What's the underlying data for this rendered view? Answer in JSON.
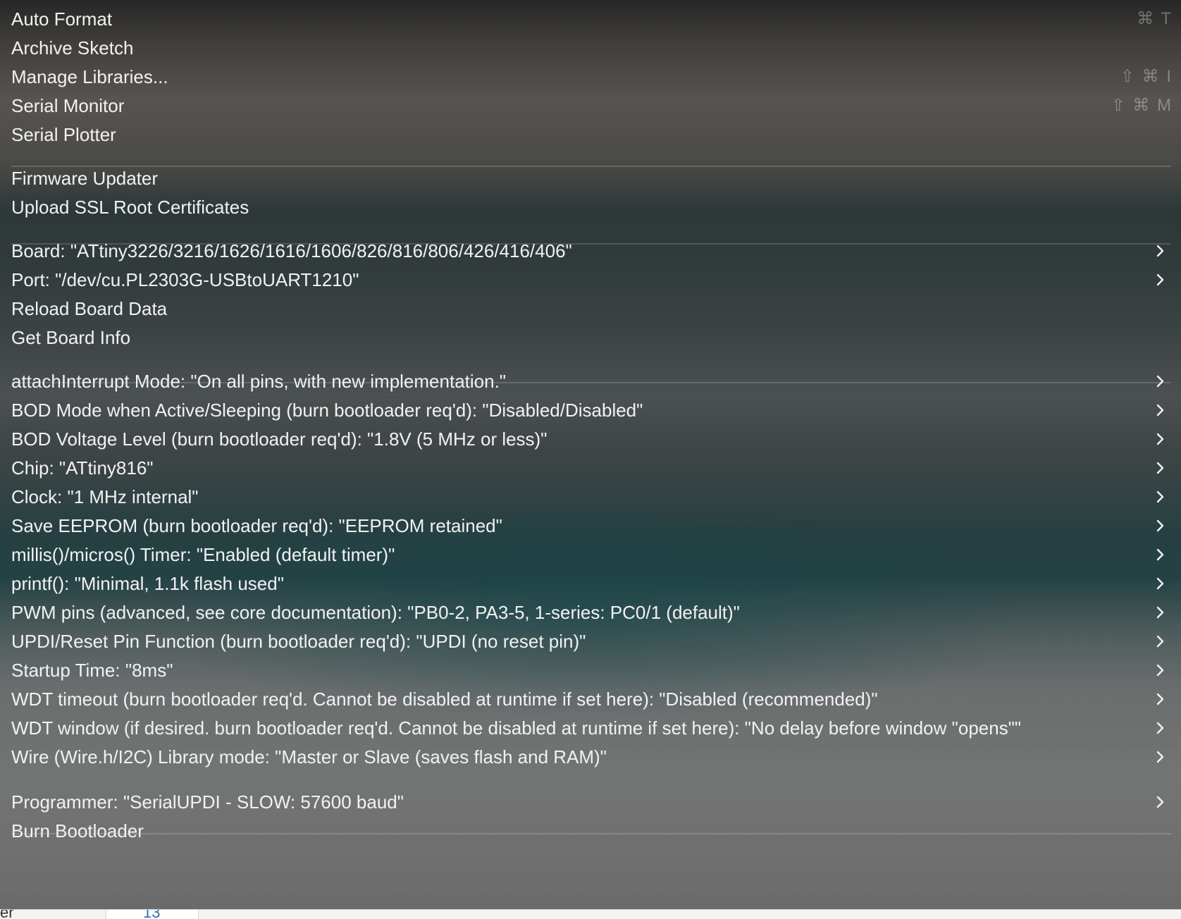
{
  "menu": {
    "group_edit": [
      {
        "label": "Auto Format",
        "shortcut": "⌘ T",
        "submenu": false
      },
      {
        "label": "Archive Sketch",
        "shortcut": "",
        "submenu": false
      },
      {
        "label": "Manage Libraries...",
        "shortcut": "⇧ ⌘ I",
        "submenu": false
      },
      {
        "label": "Serial Monitor",
        "shortcut": "⇧ ⌘ M",
        "submenu": false
      },
      {
        "label": "Serial Plotter",
        "shortcut": "",
        "submenu": false
      }
    ],
    "group_firmware": [
      {
        "label": "Firmware Updater",
        "submenu": false
      },
      {
        "label": "Upload SSL Root Certificates",
        "submenu": false
      }
    ],
    "group_board": [
      {
        "label": "Board: \"ATtiny3226/3216/1626/1616/1606/826/816/806/426/416/406\"",
        "submenu": true
      },
      {
        "label": "Port: \"/dev/cu.PL2303G-USBtoUART1210\"",
        "submenu": true
      },
      {
        "label": "Reload Board Data",
        "submenu": false
      },
      {
        "label": "Get Board Info",
        "submenu": false
      }
    ],
    "group_options": [
      {
        "label": "attachInterrupt Mode: \"On all pins, with new implementation.\"",
        "submenu": true
      },
      {
        "label": "BOD Mode when Active/Sleeping (burn bootloader req'd): \"Disabled/Disabled\"",
        "submenu": true
      },
      {
        "label": "BOD Voltage Level (burn bootloader req'd): \"1.8V (5 MHz or less)\"",
        "submenu": true
      },
      {
        "label": "Chip: \"ATtiny816\"",
        "submenu": true
      },
      {
        "label": "Clock: \"1 MHz internal\"",
        "submenu": true
      },
      {
        "label": "Save EEPROM (burn bootloader req'd): \"EEPROM retained\"",
        "submenu": true
      },
      {
        "label": "millis()/micros() Timer: \"Enabled (default timer)\"",
        "submenu": true
      },
      {
        "label": "printf(): \"Minimal, 1.1k flash used\"",
        "submenu": true
      },
      {
        "label": "PWM pins (advanced, see core documentation): \"PB0-2, PA3-5, 1-series: PC0/1 (default)\"",
        "submenu": true
      },
      {
        "label": "UPDI/Reset Pin Function (burn bootloader req'd): \"UPDI (no reset pin)\"",
        "submenu": true
      },
      {
        "label": "Startup Time: \"8ms\"",
        "submenu": true
      },
      {
        "label": "WDT timeout (burn bootloader req'd. Cannot be disabled at runtime if set here): \"Disabled (recommended)\"",
        "submenu": true
      },
      {
        "label": "WDT window (if desired. burn bootloader req'd. Cannot be disabled at runtime if set here): \"No delay before window \"opens\"\"",
        "submenu": true
      },
      {
        "label": "Wire (Wire.h/I2C) Library mode: \"Master or Slave (saves flash and RAM)\"",
        "submenu": true
      }
    ],
    "group_programmer": [
      {
        "label": "Programmer: \"SerialUPDI - SLOW: 57600 baud\"",
        "submenu": true
      },
      {
        "label": "Burn Bootloader",
        "submenu": false
      }
    ]
  },
  "background_strip": {
    "edge_text": "er",
    "line_number": "13"
  },
  "colors": {
    "menu_text": "#f2f2f2",
    "shortcut_text": "rgba(255,255,255,0.32)",
    "separator": "rgba(255,255,255,0.16)"
  }
}
